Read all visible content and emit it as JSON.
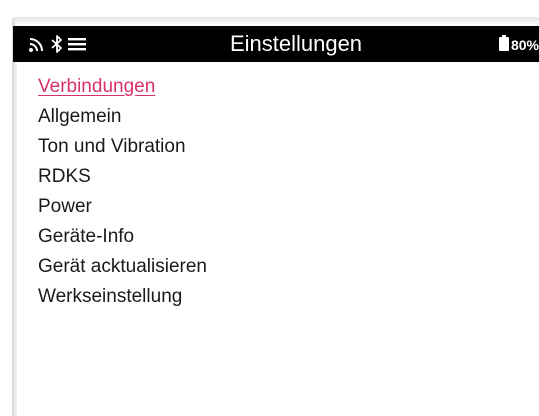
{
  "status_bar": {
    "icons": [
      "wifi-icon",
      "bluetooth-icon",
      "menu-icon",
      "battery-icon"
    ],
    "title": "Einstellungen",
    "battery_percent": "80%"
  },
  "menu": {
    "selected_index": 0,
    "selected_color": "#d8306b",
    "items": [
      {
        "label": "Verbindungen"
      },
      {
        "label": "Allgemein"
      },
      {
        "label": "Ton und Vibration"
      },
      {
        "label": "RDKS"
      },
      {
        "label": "Power"
      },
      {
        "label": "Geräte-Info"
      },
      {
        "label": "Gerät acktualisieren"
      },
      {
        "label": "Werkseinstellung"
      }
    ]
  }
}
